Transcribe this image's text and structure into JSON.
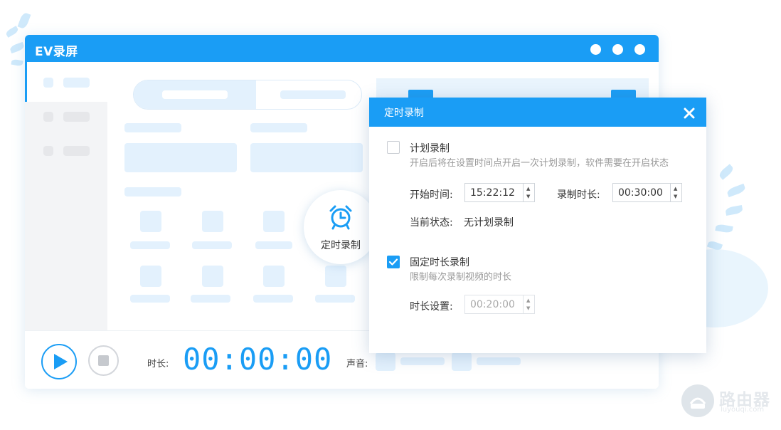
{
  "window": {
    "title": "EV录屏"
  },
  "bubble": {
    "label": "定时录制",
    "icon": "alarm-clock-icon"
  },
  "bottom_bar": {
    "duration_label": "时长:",
    "timer": "00:00:00",
    "sound_label": "声音:"
  },
  "dialog": {
    "title": "定时录制",
    "plan": {
      "checked": false,
      "title": "计划录制",
      "description": "开启后将在设置时间点开启一次计划录制，软件需要在开启状态",
      "start_label": "开始时间:",
      "start_value": "15:22:12",
      "length_label": "录制时长:",
      "length_value": "00:30:00",
      "status_label": "当前状态:",
      "status_value": "无计划录制"
    },
    "fixed": {
      "checked": true,
      "title": "固定时长录制",
      "description": "限制每次录制视频的时长",
      "duration_label": "时长设置:",
      "duration_value": "00:20:00"
    }
  },
  "watermark": {
    "text": "路由器",
    "sub": "luyouqi.com"
  },
  "colors": {
    "accent": "#1a9df5",
    "skeleton_blue": "#e3f1fd",
    "skeleton_gray": "#e6e7ea"
  }
}
